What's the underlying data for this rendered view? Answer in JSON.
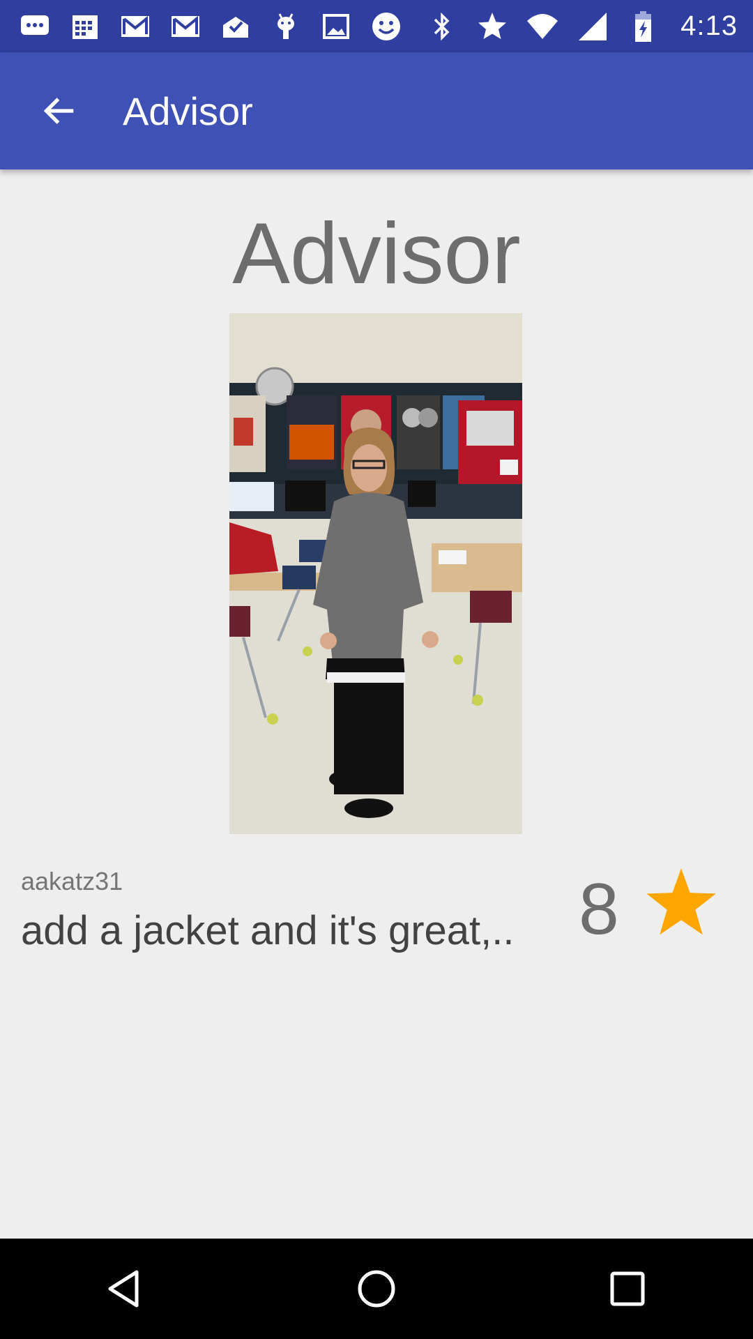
{
  "status_bar": {
    "time": "4:13",
    "left_icons": [
      "messaging-icon",
      "calendar-icon",
      "gmail-icon",
      "gmail-icon",
      "inbox-icon",
      "android-debug-icon",
      "gallery-icon",
      "smiley-icon"
    ],
    "right_icons": [
      "bluetooth-icon",
      "star-icon",
      "wifi-icon",
      "cell-signal-icon",
      "battery-charging-icon"
    ]
  },
  "app_bar": {
    "title": "Advisor",
    "back_icon": "arrow-back-icon"
  },
  "main": {
    "heading": "Advisor",
    "photo_icon": "advisor-photo",
    "username": "aakatz31",
    "comment": "add a jacket and it's great,..",
    "score": "8",
    "star_icon": "star-icon"
  },
  "nav_bar": {
    "icons": [
      "nav-back-icon",
      "nav-home-icon",
      "nav-recents-icon"
    ]
  },
  "colors": {
    "status_bar": "#303f9f",
    "app_bar": "#3f51b5",
    "background": "#eeeeee",
    "star": "#ffa500"
  }
}
